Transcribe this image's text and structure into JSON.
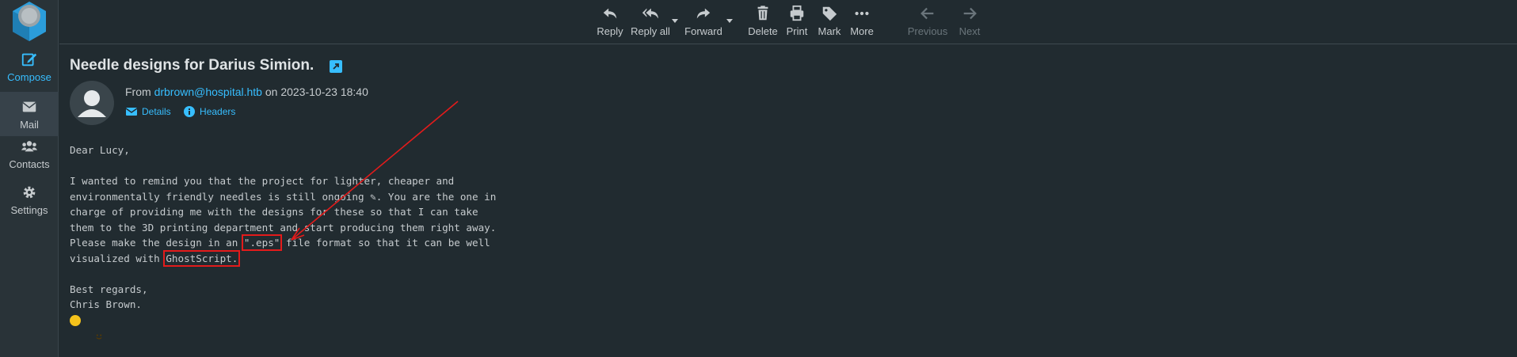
{
  "sidebar": {
    "items": [
      {
        "id": "compose",
        "label": "Compose",
        "icon": "compose-icon"
      },
      {
        "id": "mail",
        "label": "Mail",
        "icon": "mail-icon"
      },
      {
        "id": "contacts",
        "label": "Contacts",
        "icon": "contacts-icon"
      },
      {
        "id": "settings",
        "label": "Settings",
        "icon": "gear-icon"
      }
    ]
  },
  "toolbar": {
    "reply": "Reply",
    "reply_all": "Reply all",
    "forward": "Forward",
    "delete": "Delete",
    "print": "Print",
    "mark": "Mark",
    "more": "More",
    "previous": "Previous",
    "next": "Next"
  },
  "message": {
    "subject": "Needle designs for Darius Simion.",
    "from_prefix": "From",
    "from_email": "drbrown@hospital.htb",
    "date_text": "on 2023-10-23 18:40",
    "details_label": "Details",
    "headers_label": "Headers",
    "body": {
      "greeting": "Dear Lucy,",
      "line1": "I wanted to remind you that the project for lighter, cheaper and",
      "line2": "environmentally friendly needles is still ongoing ",
      "line2_after": ". You are the one in",
      "line3": "charge of providing me with the designs for these so that I can take",
      "line4": "them to the 3D printing department and start producing them right away.",
      "line5_before": "Please make the design in an ",
      "line5_highlight": "\".eps\"",
      "line5_after": " file format so that it can be well",
      "line6_before": "visualized with ",
      "line6_highlight": "GhostScript.",
      "closing": "Best regards,",
      "signature": "Chris Brown."
    }
  },
  "colors": {
    "accent": "#37beff",
    "annotation": "#e31b1b",
    "background": "#212b30",
    "sidebar": "#293338"
  }
}
